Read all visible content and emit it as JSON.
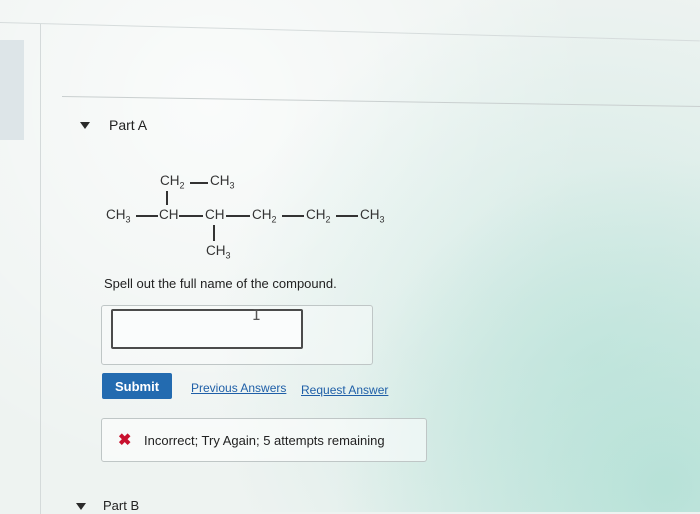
{
  "partA": {
    "title": "Part A",
    "structure": {
      "top_left": "CH2",
      "top_right": "CH3",
      "main": [
        "CH3",
        "CH",
        "CH",
        "CH2",
        "CH2",
        "CH3"
      ],
      "bottom": "CH3"
    },
    "prompt": "Spell out the full name of the compound.",
    "answer": {
      "value": "",
      "placeholder": ""
    },
    "buttons": {
      "submit": "Submit",
      "previous_answers": "Previous Answers",
      "request_answer": "Request Answer"
    },
    "feedback": {
      "icon": "close-icon",
      "text": "Incorrect; Try Again; 5 attempts remaining",
      "color": "#c8102e"
    }
  },
  "partB": {
    "title": "Part B"
  },
  "colors": {
    "accent": "#236bb0",
    "link": "#1f5fa8",
    "error": "#c8102e"
  }
}
